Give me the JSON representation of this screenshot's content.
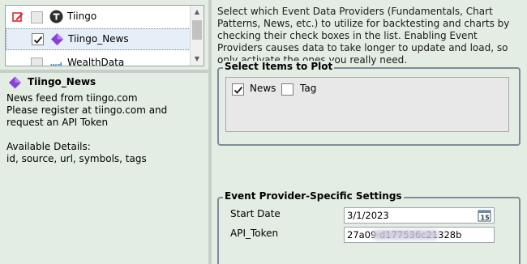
{
  "providers": [
    {
      "label": "Tiingo",
      "checked": false,
      "editable": true
    },
    {
      "label": "Tiingo_News",
      "checked": true,
      "selected": true
    },
    {
      "label": "WealthData",
      "checked": false
    }
  ],
  "detail": {
    "title": "Tiingo_News",
    "text": "News feed from tiingo.com\nPlease register at tiingo.com and request an API Token\n\nAvailable Details:\nid, source, url, symbols, tags"
  },
  "intro": "Select which Event Data Providers (Fundamentals, Chart Patterns, News, etc.) to utilize for backtesting and charts by checking their check boxes in the list. Enabling Event Providers causes data to take longer to update and load, so only activate the ones you really need.",
  "plot_items": {
    "title": "Select Items to Plot",
    "items": [
      {
        "label": "News",
        "checked": true
      },
      {
        "label": "Tag",
        "checked": false
      }
    ]
  },
  "settings": {
    "title": "Event Provider-Specific Settings",
    "start_date_label": "Start Date",
    "start_date_value": "3/1/2023",
    "api_token_label": "API_Token",
    "api_token_value": "27a09                    d177536c21328b"
  },
  "colors": {
    "accent_purple": "#8b3fd9",
    "edit_red": "#e0262a",
    "group_border": "#7e8c99"
  },
  "icons": {
    "edit": "edit-pencil-icon",
    "tiingo": "tiingo-logo-icon",
    "tiingo_news": "tiingo-news-diamond-icon",
    "wealthdata": "wealthdata-logo-icon",
    "calendar": "calendar-icon"
  }
}
